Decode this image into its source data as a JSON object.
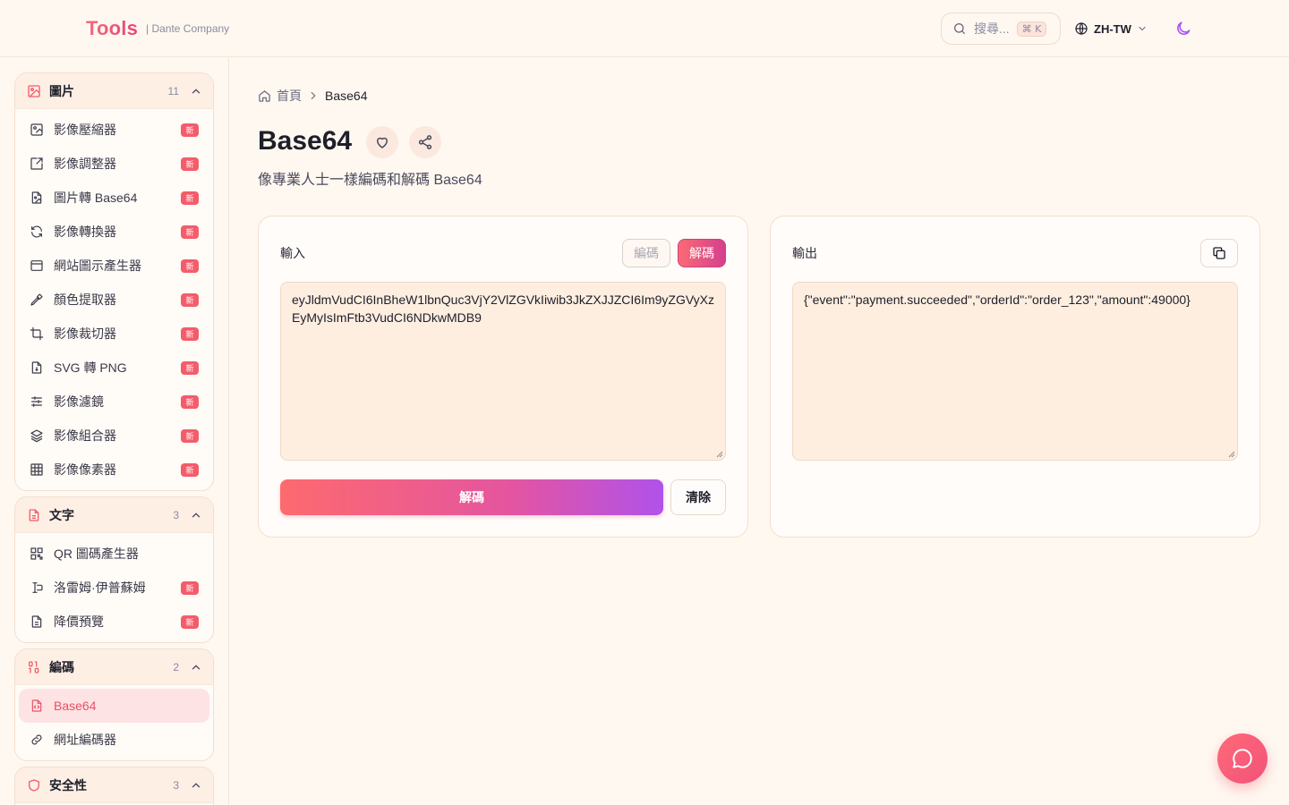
{
  "header": {
    "logo": "Tools",
    "logo_sub": "| Dante Company",
    "search_placeholder": "搜尋...",
    "search_shortcut": "⌘ K",
    "language": "ZH-TW"
  },
  "sidebar": {
    "groups": [
      {
        "title": "圖片",
        "count": "11",
        "icon": "image-icon",
        "items": [
          {
            "label": "影像壓縮器",
            "badge": "新",
            "icon": "image-compress-icon"
          },
          {
            "label": "影像調整器",
            "badge": "新",
            "icon": "resize-icon"
          },
          {
            "label": "圖片轉 Base64",
            "badge": "新",
            "icon": "file-image-icon"
          },
          {
            "label": "影像轉換器",
            "badge": "新",
            "icon": "refresh-icon"
          },
          {
            "label": "網站圖示產生器",
            "badge": "新",
            "icon": "browser-icon"
          },
          {
            "label": "顏色提取器",
            "badge": "新",
            "icon": "eyedropper-icon"
          },
          {
            "label": "影像裁切器",
            "badge": "新",
            "icon": "crop-icon"
          },
          {
            "label": "SVG 轉 PNG",
            "badge": "新",
            "icon": "file-convert-icon"
          },
          {
            "label": "影像濾鏡",
            "badge": "新",
            "icon": "sliders-icon"
          },
          {
            "label": "影像組合器",
            "badge": "新",
            "icon": "layers-icon"
          },
          {
            "label": "影像像素器",
            "badge": "新",
            "icon": "grid-icon"
          }
        ]
      },
      {
        "title": "文字",
        "count": "3",
        "icon": "text-file-icon",
        "items": [
          {
            "label": "QR 圖碼產生器",
            "badge": "",
            "icon": "qr-icon"
          },
          {
            "label": "洛雷姆·伊普蘇姆",
            "badge": "新",
            "icon": "text-cursor-icon"
          },
          {
            "label": "降價預覽",
            "badge": "新",
            "icon": "document-icon"
          }
        ]
      },
      {
        "title": "編碼",
        "count": "2",
        "icon": "binary-icon",
        "items": [
          {
            "label": "Base64",
            "badge": "",
            "icon": "file-code-icon",
            "active": true
          },
          {
            "label": "網址編碼器",
            "badge": "",
            "icon": "link-icon"
          }
        ]
      },
      {
        "title": "安全性",
        "count": "3",
        "icon": "shield-icon",
        "items": []
      }
    ]
  },
  "breadcrumb": {
    "home": "首頁",
    "current": "Base64"
  },
  "page": {
    "title": "Base64",
    "subtitle": "像專業人士一樣編碼和解碼 Base64"
  },
  "input_card": {
    "label": "輸入",
    "encode_label": "編碼",
    "decode_label": "解碼",
    "value": "eyJldmVudCI6InBheW1lbnQuc3VjY2VlZGVkIiwib3JkZXJJZCI6Im9yZGVyXzEyMyIsImFtb3VudCI6NDkwMDB9",
    "run_label": "解碼",
    "clear_label": "清除"
  },
  "output_card": {
    "label": "輸出",
    "value": "{\"event\":\"payment.succeeded\",\"orderId\":\"order_123\",\"amount\":49000}"
  },
  "colors": {
    "accent": "#f45c6b",
    "background": "#fff8f1",
    "active_item_bg": "#fde3e3"
  }
}
